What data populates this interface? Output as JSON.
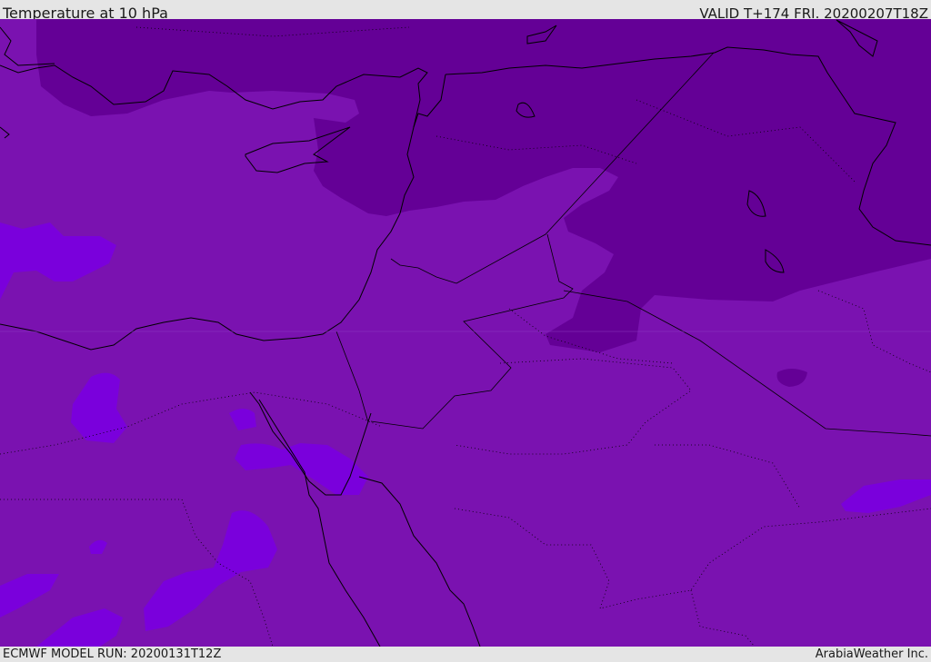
{
  "header": {
    "title": "Temperature at 10 hPa",
    "valid": "VALID T+174 FRI. 20200207T18Z"
  },
  "footer": {
    "model_run": "ECMWF MODEL RUN: 20200131T12Z",
    "credit": "ArabiaWeather Inc."
  },
  "colors": {
    "cold_band": "#640096",
    "mid_band": "#7a12b0",
    "warm_band": "#7a00dc",
    "coast": "#000000"
  }
}
